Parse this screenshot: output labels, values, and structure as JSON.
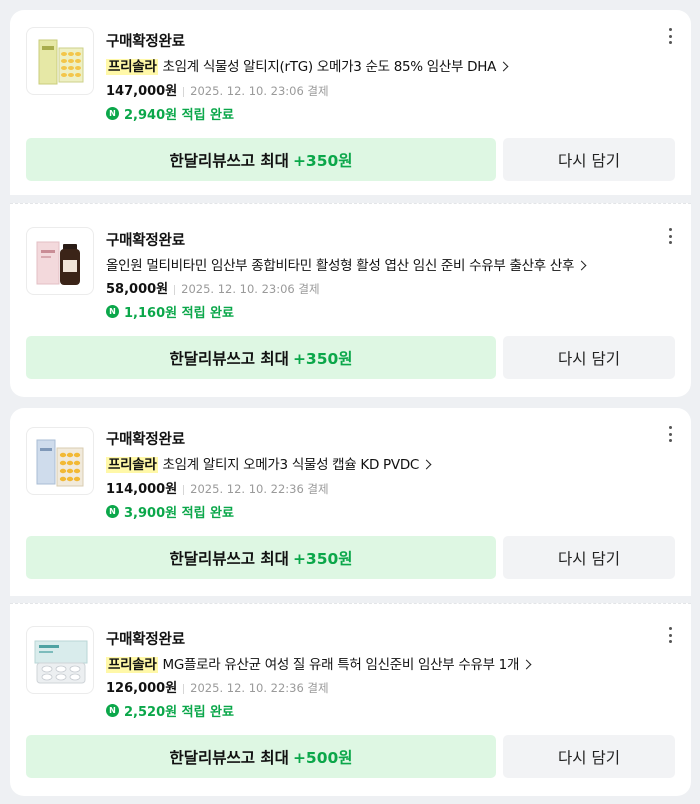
{
  "orders": [
    {
      "status": "구매확정완료",
      "brand": "프리솔라",
      "title": "초임계 식물성 알티지(rTG) 오메가3 순도 85% 임산부 DHA",
      "price": "147,000원",
      "paid_at": "2025. 12. 10. 23:06 결제",
      "points": "2,940원 적립 완료",
      "review_label": "한달리뷰쓰고 최대",
      "review_bonus": "+350원",
      "cart_label": "다시 담기"
    },
    {
      "status": "구매확정완료",
      "brand": "",
      "title": "올인원 멀티비타민 임산부 종합비타민 활성형 활성 엽산 임신 준비 수유부 출산후 산후",
      "price": "58,000원",
      "paid_at": "2025. 12. 10. 23:06 결제",
      "points": "1,160원 적립 완료",
      "review_label": "한달리뷰쓰고 최대",
      "review_bonus": "+350원",
      "cart_label": "다시 담기"
    },
    {
      "status": "구매확정완료",
      "brand": "프리솔라",
      "title": "초임계 알티지 오메가3 식물성 캡슐 KD PVDC",
      "price": "114,000원",
      "paid_at": "2025. 12. 10. 22:36 결제",
      "points": "3,900원 적립 완료",
      "review_label": "한달리뷰쓰고 최대",
      "review_bonus": "+350원",
      "cart_label": "다시 담기"
    },
    {
      "status": "구매확정완료",
      "brand": "프리솔라",
      "title": "MG플로라 유산균 여성 질 유래 특허 임신준비 임산부 수유부 1개",
      "price": "126,000원",
      "paid_at": "2025. 12. 10. 22:36 결제",
      "points": "2,520원 적립 완료",
      "review_label": "한달리뷰쓰고 최대",
      "review_bonus": "+500원",
      "cart_label": "다시 담기"
    }
  ],
  "points_icon": "N",
  "icons": {
    "more": "more-vertical-icon",
    "chevron": "chevron-right-icon",
    "points": "naver-points-icon"
  },
  "colors": {
    "accent_green": "#0ba74a",
    "review_button_bg": "#def7e3",
    "brand_highlight": "#fff8a8"
  }
}
